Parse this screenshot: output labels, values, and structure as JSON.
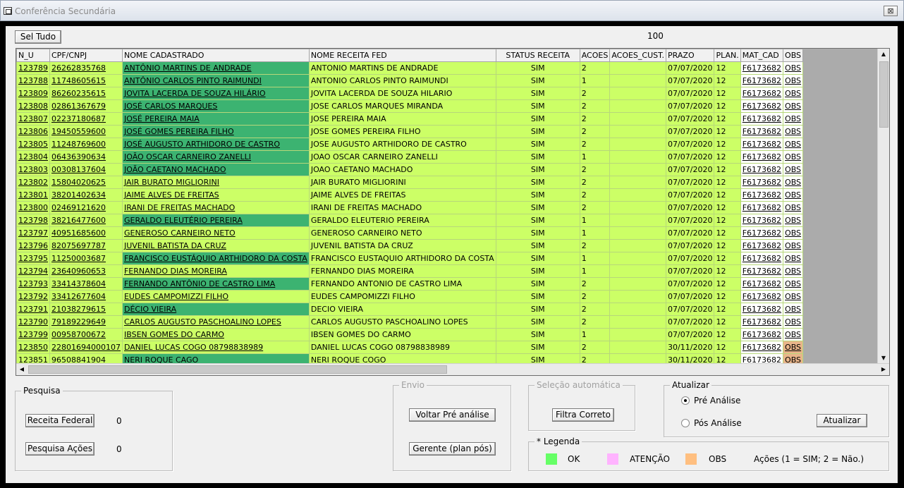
{
  "window": {
    "title": "Conferência Secundária",
    "close_glyph": "⊠"
  },
  "toolbar": {
    "select_all_label": "Sel Tudo",
    "count": "100"
  },
  "grid": {
    "columns": [
      "N_U",
      "CPF/CNPJ",
      "NOME CADASTRADO",
      "NOME RECEITA FED",
      "STATUS RECEITA",
      "ACOES",
      "ACOES_CUST.",
      "PRAZO",
      "PLAN.",
      "MAT_CAD",
      "OBS"
    ],
    "rows": [
      {
        "nu": "123789",
        "cpf": "26262835768",
        "nome": "ANTÔNIO MARTINS DE ANDRADE",
        "receita": "ANTONIO MARTINS DE ANDRADE",
        "status": "SIM",
        "acoes": "2",
        "cust": "",
        "prazo": "07/07/2020",
        "plan": "12",
        "mat": "F6173682",
        "obs": "OBS",
        "dark": true,
        "obs_color": "white"
      },
      {
        "nu": "123788",
        "cpf": "11748605615",
        "nome": "ANTÔNIO CARLOS PINTO RAIMUNDI",
        "receita": "ANTONIO CARLOS PINTO RAIMUNDI",
        "status": "SIM",
        "acoes": "1",
        "cust": "",
        "prazo": "07/07/2020",
        "plan": "12",
        "mat": "F6173682",
        "obs": "OBS",
        "dark": true,
        "obs_color": "white"
      },
      {
        "nu": "123809",
        "cpf": "86260235615",
        "nome": "JOVITA LACERDA DE SOUZA HILÁRIO",
        "receita": "JOVITA LACERDA DE SOUZA HILARIO",
        "status": "SIM",
        "acoes": "2",
        "cust": "",
        "prazo": "07/07/2020",
        "plan": "12",
        "mat": "F6173682",
        "obs": "OBS",
        "dark": true,
        "obs_color": "white"
      },
      {
        "nu": "123808",
        "cpf": "02861367679",
        "nome": "JOSÉ CARLOS MARQUES",
        "receita": "JOSE CARLOS MARQUES MIRANDA",
        "status": "SIM",
        "acoes": "2",
        "cust": "",
        "prazo": "07/07/2020",
        "plan": "12",
        "mat": "F6173682",
        "obs": "OBS",
        "dark": true,
        "obs_color": "white"
      },
      {
        "nu": "123807",
        "cpf": "02237180687",
        "nome": "JOSÉ PEREIRA MAIA",
        "receita": "JOSE PEREIRA MAIA",
        "status": "SIM",
        "acoes": "2",
        "cust": "",
        "prazo": "07/07/2020",
        "plan": "12",
        "mat": "F6173682",
        "obs": "OBS",
        "dark": true,
        "obs_color": "white"
      },
      {
        "nu": "123806",
        "cpf": "19450559600",
        "nome": "JOSÉ GOMES PEREIRA FILHO",
        "receita": "JOSE GOMES PEREIRA FILHO",
        "status": "SIM",
        "acoes": "2",
        "cust": "",
        "prazo": "07/07/2020",
        "plan": "12",
        "mat": "F6173682",
        "obs": "OBS",
        "dark": true,
        "obs_color": "white"
      },
      {
        "nu": "123805",
        "cpf": "11248769600",
        "nome": "JOSÉ AUGUSTO ARTHIDORO DE CASTRO",
        "receita": "JOSE AUGUSTO ARTHIDORO DE CASTRO",
        "status": "SIM",
        "acoes": "2",
        "cust": "",
        "prazo": "07/07/2020",
        "plan": "12",
        "mat": "F6173682",
        "obs": "OBS",
        "dark": true,
        "obs_color": "white"
      },
      {
        "nu": "123804",
        "cpf": "06436390634",
        "nome": "JOÃO OSCAR CARNEIRO ZANELLI",
        "receita": "JOAO OSCAR CARNEIRO ZANELLI",
        "status": "SIM",
        "acoes": "1",
        "cust": "",
        "prazo": "07/07/2020",
        "plan": "12",
        "mat": "F6173682",
        "obs": "OBS",
        "dark": true,
        "obs_color": "white"
      },
      {
        "nu": "123803",
        "cpf": "00308137604",
        "nome": "JOÃO CAETANO MACHADO",
        "receita": "JOAO CAETANO MACHADO",
        "status": "SIM",
        "acoes": "2",
        "cust": "",
        "prazo": "07/07/2020",
        "plan": "12",
        "mat": "F6173682",
        "obs": "OBS",
        "dark": true,
        "obs_color": "white"
      },
      {
        "nu": "123802",
        "cpf": "15804020625",
        "nome": "JAIR BURATO MIGLIORINI",
        "receita": "JAIR BURATO MIGLIORINI",
        "status": "SIM",
        "acoes": "2",
        "cust": "",
        "prazo": "07/07/2020",
        "plan": "12",
        "mat": "F6173682",
        "obs": "OBS",
        "dark": false,
        "obs_color": "white"
      },
      {
        "nu": "123801",
        "cpf": "38201402634",
        "nome": "JAIME ALVES DE FREITAS",
        "receita": "JAIME ALVES DE FREITAS",
        "status": "SIM",
        "acoes": "2",
        "cust": "",
        "prazo": "07/07/2020",
        "plan": "12",
        "mat": "F6173682",
        "obs": "OBS",
        "dark": false,
        "obs_color": "white"
      },
      {
        "nu": "123800",
        "cpf": "02469121620",
        "nome": "IRANI DE FREITAS MACHADO",
        "receita": "IRANI DE FREITAS MACHADO",
        "status": "SIM",
        "acoes": "2",
        "cust": "",
        "prazo": "07/07/2020",
        "plan": "12",
        "mat": "F6173682",
        "obs": "OBS",
        "dark": false,
        "obs_color": "white"
      },
      {
        "nu": "123798",
        "cpf": "38216477600",
        "nome": "GERALDO ELEUTÉRIO PEREIRA",
        "receita": "GERALDO ELEUTERIO PEREIRA",
        "status": "SIM",
        "acoes": "1",
        "cust": "",
        "prazo": "07/07/2020",
        "plan": "12",
        "mat": "F6173682",
        "obs": "OBS",
        "dark": true,
        "obs_color": "white"
      },
      {
        "nu": "123797",
        "cpf": "40951685600",
        "nome": "GENEROSO CARNEIRO NETO",
        "receita": "GENEROSO CARNEIRO NETO",
        "status": "SIM",
        "acoes": "1",
        "cust": "",
        "prazo": "07/07/2020",
        "plan": "12",
        "mat": "F6173682",
        "obs": "OBS",
        "dark": false,
        "obs_color": "white"
      },
      {
        "nu": "123796",
        "cpf": "82075697787",
        "nome": "JUVENIL BATISTA DA CRUZ",
        "receita": "JUVENIL BATISTA DA CRUZ",
        "status": "SIM",
        "acoes": "2",
        "cust": "",
        "prazo": "07/07/2020",
        "plan": "12",
        "mat": "F6173682",
        "obs": "OBS",
        "dark": false,
        "obs_color": "white"
      },
      {
        "nu": "123795",
        "cpf": "11250003687",
        "nome": "FRANCISCO EUSTÁQUIO ARTHIDORO DA COSTA",
        "receita": "FRANCISCO EUSTAQUIO ARTHIDORO DA COSTA",
        "status": "SIM",
        "acoes": "1",
        "cust": "",
        "prazo": "07/07/2020",
        "plan": "12",
        "mat": "F6173682",
        "obs": "OBS",
        "dark": true,
        "obs_color": "white"
      },
      {
        "nu": "123794",
        "cpf": "23640960653",
        "nome": "FERNANDO DIAS MOREIRA",
        "receita": "FERNANDO DIAS MOREIRA",
        "status": "SIM",
        "acoes": "1",
        "cust": "",
        "prazo": "07/07/2020",
        "plan": "12",
        "mat": "F6173682",
        "obs": "OBS",
        "dark": false,
        "obs_color": "white"
      },
      {
        "nu": "123793",
        "cpf": "33414378604",
        "nome": "FERNANDO ANTÔNIO DE CASTRO LIMA",
        "receita": "FERNANDO ANTONIO DE CASTRO LIMA",
        "status": "SIM",
        "acoes": "2",
        "cust": "",
        "prazo": "07/07/2020",
        "plan": "12",
        "mat": "F6173682",
        "obs": "OBS",
        "dark": true,
        "obs_color": "white"
      },
      {
        "nu": "123792",
        "cpf": "33412677604",
        "nome": "EUDES CAMPOMIZZI FILHO",
        "receita": "EUDES CAMPOMIZZI FILHO",
        "status": "SIM",
        "acoes": "2",
        "cust": "",
        "prazo": "07/07/2020",
        "plan": "12",
        "mat": "F6173682",
        "obs": "OBS",
        "dark": false,
        "obs_color": "white"
      },
      {
        "nu": "123791",
        "cpf": "21038279615",
        "nome": "DÉCIO VIEIRA",
        "receita": "DECIO VIEIRA",
        "status": "SIM",
        "acoes": "2",
        "cust": "",
        "prazo": "07/07/2020",
        "plan": "12",
        "mat": "F6173682",
        "obs": "OBS",
        "dark": true,
        "obs_color": "white"
      },
      {
        "nu": "123790",
        "cpf": "79189229649",
        "nome": "CARLOS AUGUSTO PASCHOALINO LOPES",
        "receita": "CARLOS AUGUSTO PASCHOALINO LOPES",
        "status": "SIM",
        "acoes": "2",
        "cust": "",
        "prazo": "07/07/2020",
        "plan": "12",
        "mat": "F6173682",
        "obs": "OBS",
        "dark": false,
        "obs_color": "white"
      },
      {
        "nu": "123799",
        "cpf": "00958700672",
        "nome": "IBSEN GOMES DO CARMO",
        "receita": "IBSEN GOMES DO CARMO",
        "status": "SIM",
        "acoes": "1",
        "cust": "",
        "prazo": "07/07/2020",
        "plan": "12",
        "mat": "F6173682",
        "obs": "OBS",
        "dark": false,
        "obs_color": "white"
      },
      {
        "nu": "123850",
        "cpf": "22801694000107",
        "nome": "DANIEL LUCAS COGO 08798838989",
        "receita": "DANIEL LUCAS COGO 08798838989",
        "status": "SIM",
        "acoes": "2",
        "cust": "",
        "prazo": "30/11/2020",
        "plan": "12",
        "mat": "F6173682",
        "obs": "OBS",
        "dark": false,
        "obs_color": "orange"
      },
      {
        "nu": "123851",
        "cpf": "96508841904",
        "nome": "NERI ROQUE CAGO",
        "receita": "NERI ROQUE COGO",
        "status": "SIM",
        "acoes": "2",
        "cust": "",
        "prazo": "30/11/2020",
        "plan": "12",
        "mat": "F6173682",
        "obs": "OBS",
        "dark": true,
        "obs_color": "orange"
      }
    ]
  },
  "pesquisa": {
    "title": "Pesquisa",
    "receita_label": "Receita Federal",
    "receita_count": "0",
    "acoes_label": "Pesquisa Ações",
    "acoes_count": "0"
  },
  "envio": {
    "title": "Envio",
    "voltar_label": "Voltar Pré análise",
    "gerente_label": "Gerente (plan pós)"
  },
  "selecao": {
    "title": "Seleção automática",
    "filtra_label": "Filtra Correto"
  },
  "atualizar": {
    "title": "Atualizar",
    "pre_label": "Pré Análise",
    "pos_label": "Pós Análise",
    "selected": "pre",
    "button_label": "Atualizar"
  },
  "legenda": {
    "title": "* Legenda",
    "items": [
      {
        "label": "OK",
        "color": "#66ff66"
      },
      {
        "label": "ATENÇÃO",
        "color": "#ffb3ff"
      },
      {
        "label": "OBS",
        "color": "#ffbf80"
      }
    ],
    "note": "Ações (1 = SIM; 2 = Não.)"
  },
  "colors": {
    "row_light": "#ccff66",
    "row_dark": "#3cb371",
    "obs_orange": "#e9b58a"
  }
}
